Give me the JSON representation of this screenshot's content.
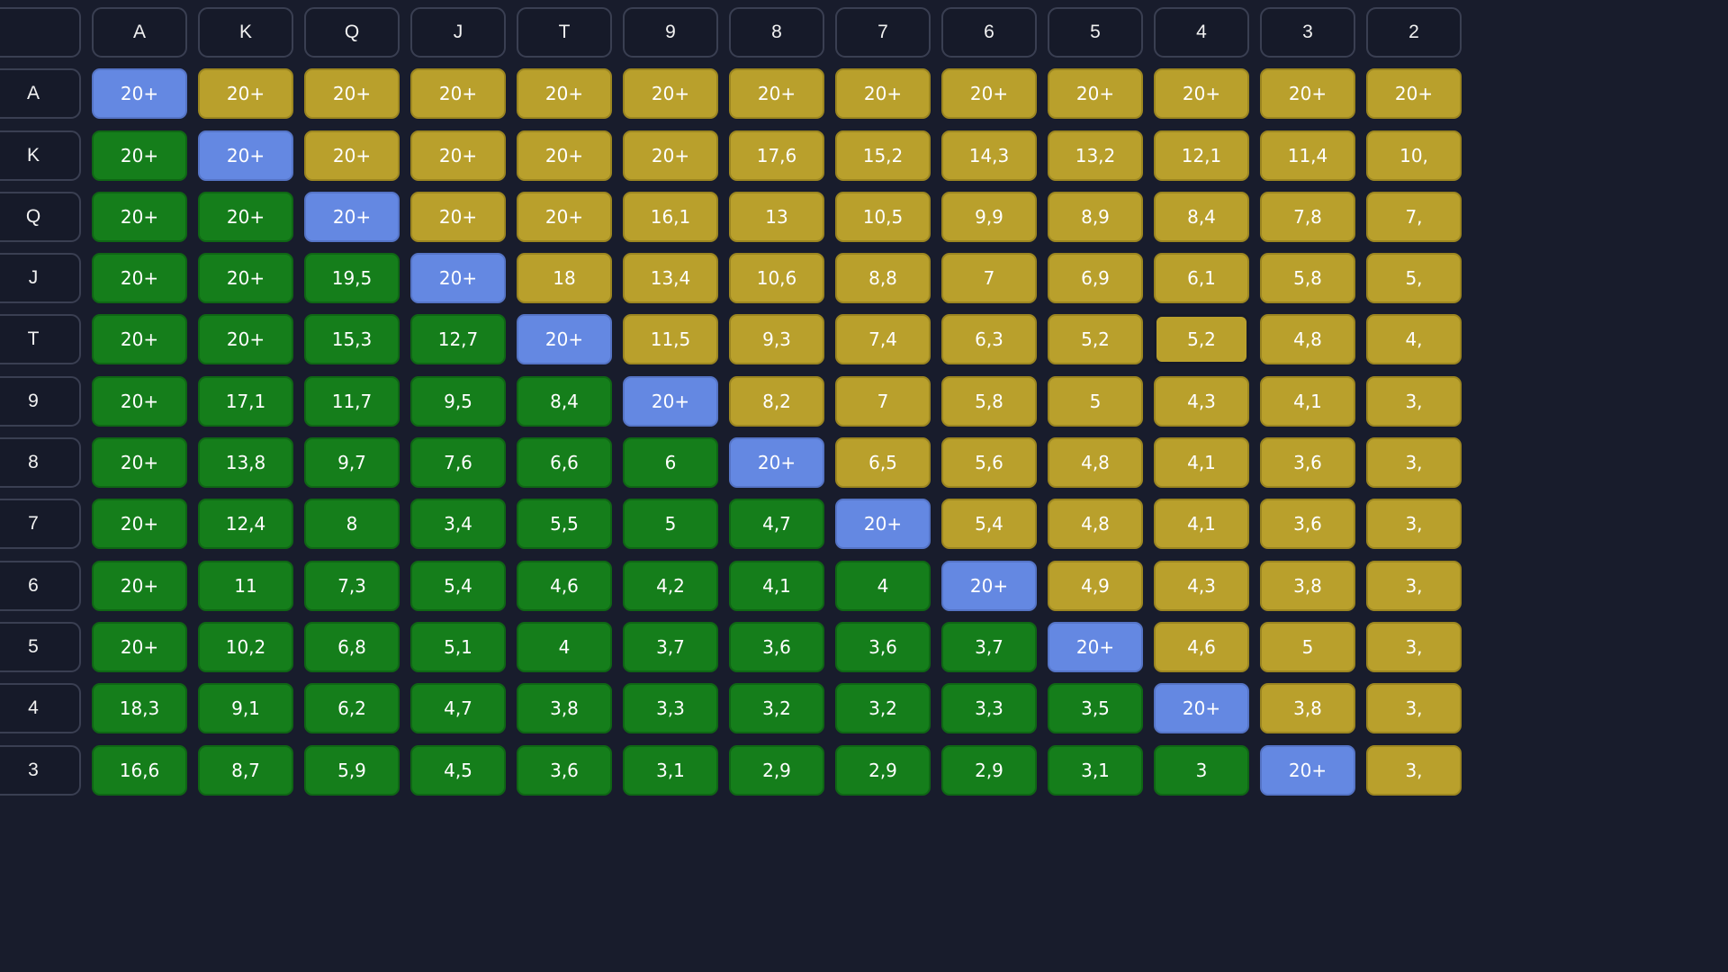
{
  "ranks": [
    "A",
    "K",
    "Q",
    "J",
    "T",
    "9",
    "8",
    "7",
    "6",
    "5",
    "4",
    "3",
    "2"
  ],
  "col_headers": [
    "A",
    "K",
    "Q",
    "J",
    "T",
    "9",
    "8",
    "7",
    "6",
    "5",
    "4",
    "3",
    "2"
  ],
  "row_headers": [
    "A",
    "K",
    "Q",
    "J",
    "T",
    "9",
    "8",
    "7",
    "6",
    "5",
    "4",
    "3"
  ],
  "corner_label": "",
  "highlighted_cell": "T4",
  "colors": {
    "suited": "#b9a02c",
    "offsuit": "#157e1b",
    "pair": "#6488e2",
    "background": "#181c2c",
    "header_bg": "#161a29"
  },
  "grid": [
    [
      "20+",
      "20+",
      "20+",
      "20+",
      "20+",
      "20+",
      "20+",
      "20+",
      "20+",
      "20+",
      "20+",
      "20+",
      "20+"
    ],
    [
      "20+",
      "20+",
      "20+",
      "20+",
      "20+",
      "20+",
      "17,6",
      "15,2",
      "14,3",
      "13,2",
      "12,1",
      "11,4",
      "10,"
    ],
    [
      "20+",
      "20+",
      "20+",
      "20+",
      "20+",
      "16,1",
      "13",
      "10,5",
      "9,9",
      "8,9",
      "8,4",
      "7,8",
      "7,"
    ],
    [
      "20+",
      "20+",
      "19,5",
      "20+",
      "18",
      "13,4",
      "10,6",
      "8,8",
      "7",
      "6,9",
      "6,1",
      "5,8",
      "5,"
    ],
    [
      "20+",
      "20+",
      "15,3",
      "12,7",
      "20+",
      "11,5",
      "9,3",
      "7,4",
      "6,3",
      "5,2",
      "5,2",
      "4,8",
      "4,"
    ],
    [
      "20+",
      "17,1",
      "11,7",
      "9,5",
      "8,4",
      "20+",
      "8,2",
      "7",
      "5,8",
      "5",
      "4,3",
      "4,1",
      "3,"
    ],
    [
      "20+",
      "13,8",
      "9,7",
      "7,6",
      "6,6",
      "6",
      "20+",
      "6,5",
      "5,6",
      "4,8",
      "4,1",
      "3,6",
      "3,"
    ],
    [
      "20+",
      "12,4",
      "8",
      "3,4",
      "5,5",
      "5",
      "4,7",
      "20+",
      "5,4",
      "4,8",
      "4,1",
      "3,6",
      "3,"
    ],
    [
      "20+",
      "11",
      "7,3",
      "5,4",
      "4,6",
      "4,2",
      "4,1",
      "4",
      "20+",
      "4,9",
      "4,3",
      "3,8",
      "3,"
    ],
    [
      "20+",
      "10,2",
      "6,8",
      "5,1",
      "4",
      "3,7",
      "3,6",
      "3,6",
      "3,7",
      "20+",
      "4,6",
      "5",
      "3,"
    ],
    [
      "18,3",
      "9,1",
      "6,2",
      "4,7",
      "3,8",
      "3,3",
      "3,2",
      "3,2",
      "3,3",
      "3,5",
      "20+",
      "3,8",
      "3,"
    ],
    [
      "16,6",
      "8,7",
      "5,9",
      "4,5",
      "3,6",
      "3,1",
      "2,9",
      "2,9",
      "2,9",
      "3,1",
      "3",
      "20+",
      "3,"
    ]
  ]
}
